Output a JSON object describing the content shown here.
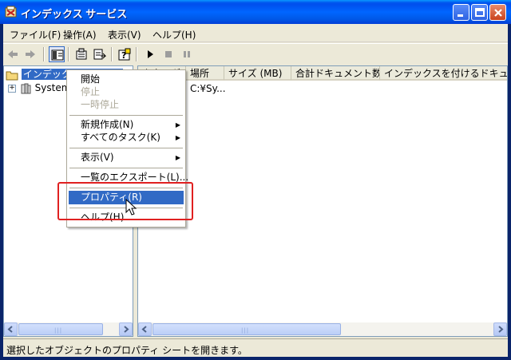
{
  "window": {
    "title": "インデックス サービス",
    "icon": "indexing-service-icon"
  },
  "menubar": {
    "items": [
      "ファイル(F)",
      "操作(A)",
      "表示(V)",
      "ヘルプ(H)"
    ]
  },
  "toolbar": {
    "icons": [
      "back-arrow-icon",
      "forward-arrow-icon",
      "show-hide-tree-icon",
      "properties-icon",
      "export-list-icon",
      "help-icon",
      "start-icon",
      "stop-icon",
      "pause-icon"
    ]
  },
  "tree": {
    "root_label": "インデックス サービス",
    "child_label": "System"
  },
  "list": {
    "columns": [
      "カタログ",
      "場所",
      "サイズ (MB)",
      "合計ドキュメント数",
      "インデックスを付けるドキュメント"
    ],
    "rows": [
      {
        "location": "C:¥Sy..."
      }
    ]
  },
  "context_menu": {
    "items": [
      {
        "label": "開始",
        "disabled": false
      },
      {
        "label": "停止",
        "disabled": true
      },
      {
        "label": "一時停止",
        "disabled": true
      },
      {
        "label": "新規作成(N)",
        "submenu": true
      },
      {
        "label": "すべてのタスク(K)",
        "submenu": true
      },
      {
        "label": "表示(V)",
        "submenu": true
      },
      {
        "label": "一覧のエクスポート(L)..."
      },
      {
        "label": "プロパティ(R)",
        "highlighted": true
      },
      {
        "label": "ヘルプ(H)"
      }
    ]
  },
  "statusbar": {
    "text": "選択したオブジェクトのプロパティ シートを開きます。"
  },
  "colors": {
    "title_bar": "#0058e6",
    "selection": "#316ac5",
    "annotation_box": "#e02020"
  }
}
